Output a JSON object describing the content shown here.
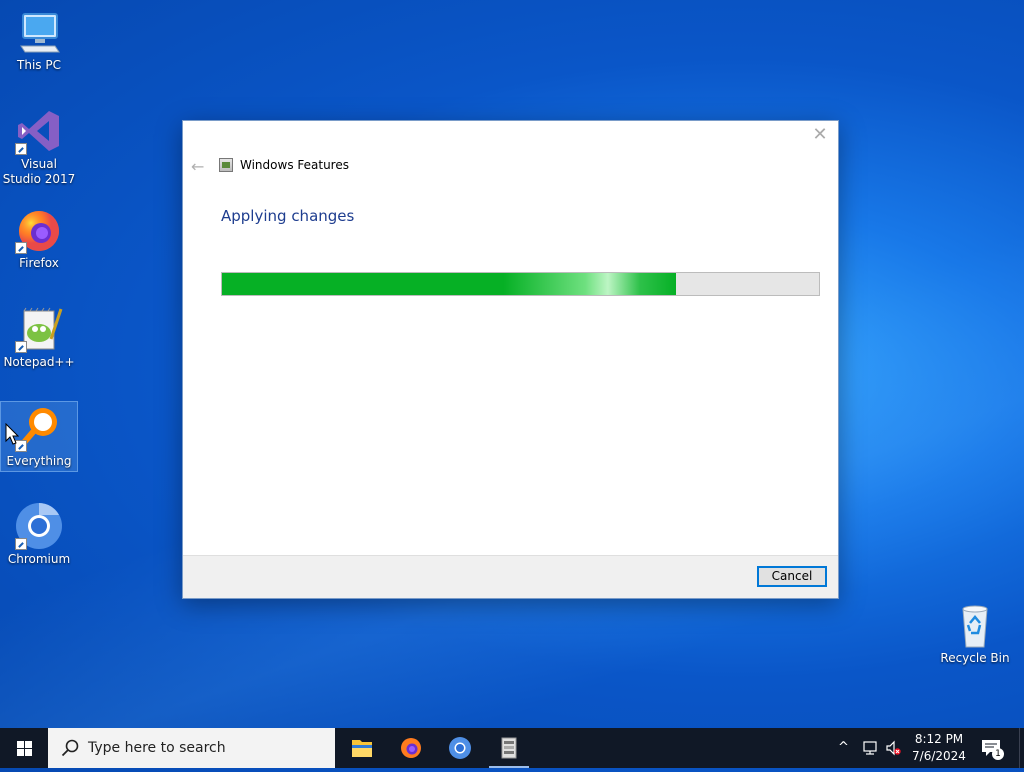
{
  "desktop": {
    "icons": [
      {
        "label": "This PC"
      },
      {
        "label": "Visual Studio 2017"
      },
      {
        "label": "Firefox"
      },
      {
        "label": "Notepad++"
      },
      {
        "label": "Everything"
      },
      {
        "label": "Chromium"
      },
      {
        "label": "Recycle Bin"
      }
    ]
  },
  "dialog": {
    "title": "Windows Features",
    "heading": "Applying changes",
    "progress_percent": 76,
    "close_glyph": "✕",
    "back_glyph": "←",
    "cancel_label": "Cancel"
  },
  "taskbar": {
    "search_placeholder": "Type here to search",
    "time": "8:12 PM",
    "date": "7/6/2024",
    "notification_count": "1",
    "tray_chevron": "^"
  },
  "colors": {
    "progress_fill": "#06b025",
    "accent": "#0078d7",
    "heading": "#1e3d8f"
  }
}
